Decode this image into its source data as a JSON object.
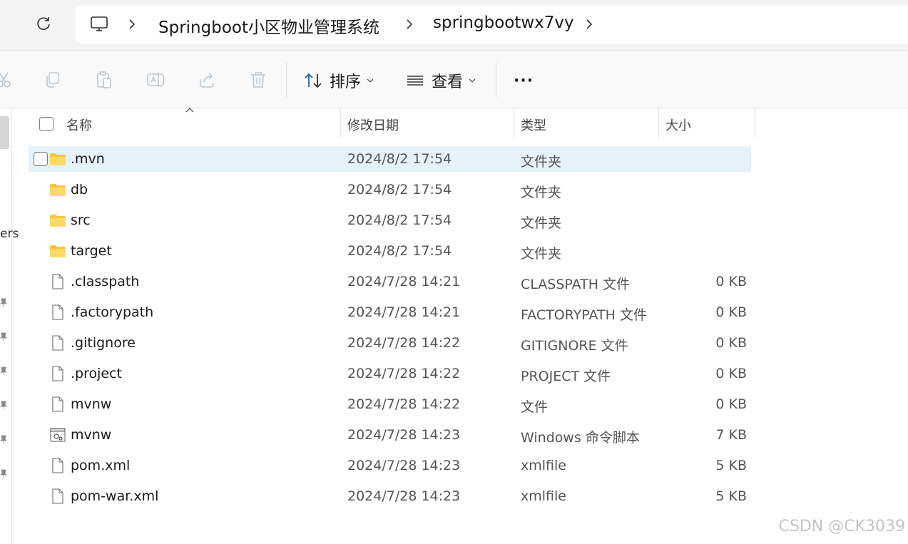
{
  "breadcrumb": {
    "items": [
      "Springboot小区物业管理系统",
      "springbootwx7vy"
    ]
  },
  "toolbar": {
    "sort_label": "排序",
    "view_label": "查看",
    "more_label": "···"
  },
  "nav": {
    "fragment_text": "ers"
  },
  "columns": {
    "name": "名称",
    "date": "修改日期",
    "type": "类型",
    "size": "大小"
  },
  "files": [
    {
      "name": ".mvn",
      "date": "2024/8/2 17:54",
      "type": "文件夹",
      "size": "",
      "icon": "folder-icon",
      "selected": true
    },
    {
      "name": "db",
      "date": "2024/8/2 17:54",
      "type": "文件夹",
      "size": "",
      "icon": "folder-icon"
    },
    {
      "name": "src",
      "date": "2024/8/2 17:54",
      "type": "文件夹",
      "size": "",
      "icon": "folder-icon"
    },
    {
      "name": "target",
      "date": "2024/8/2 17:54",
      "type": "文件夹",
      "size": "",
      "icon": "folder-icon"
    },
    {
      "name": ".classpath",
      "date": "2024/7/28 14:21",
      "type": "CLASSPATH 文件",
      "size": "0 KB",
      "icon": "file-icon"
    },
    {
      "name": ".factorypath",
      "date": "2024/7/28 14:21",
      "type": "FACTORYPATH 文件",
      "size": "0 KB",
      "icon": "file-icon"
    },
    {
      "name": ".gitignore",
      "date": "2024/7/28 14:22",
      "type": "GITIGNORE 文件",
      "size": "0 KB",
      "icon": "file-icon"
    },
    {
      "name": ".project",
      "date": "2024/7/28 14:22",
      "type": "PROJECT 文件",
      "size": "0 KB",
      "icon": "file-icon"
    },
    {
      "name": "mvnw",
      "date": "2024/7/28 14:22",
      "type": "文件",
      "size": "0 KB",
      "icon": "file-icon"
    },
    {
      "name": "mvnw",
      "date": "2024/7/28 14:23",
      "type": "Windows 命令脚本",
      "size": "7 KB",
      "icon": "script-icon"
    },
    {
      "name": "pom.xml",
      "date": "2024/7/28 14:23",
      "type": "xmlfile",
      "size": "5 KB",
      "icon": "file-icon"
    },
    {
      "name": "pom-war.xml",
      "date": "2024/7/28 14:23",
      "type": "xmlfile",
      "size": "5 KB",
      "icon": "file-icon"
    }
  ],
  "watermark": "CSDN @CK3039"
}
